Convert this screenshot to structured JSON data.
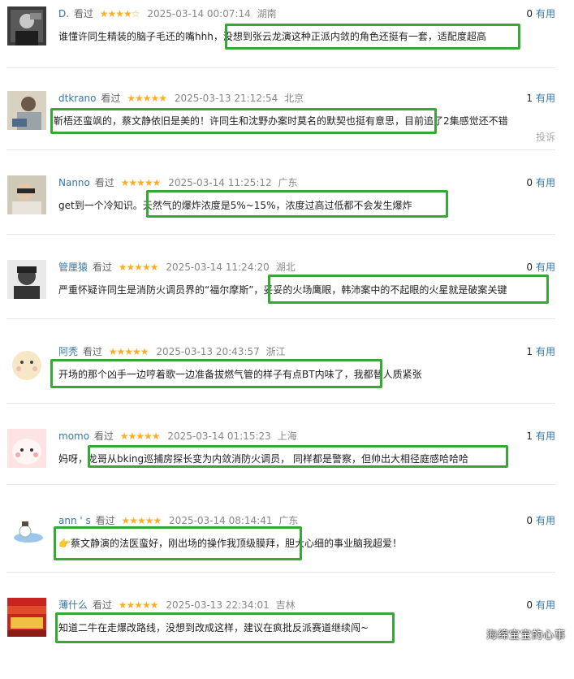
{
  "labels": {
    "watched": "看过",
    "useful": "有用",
    "report": "投诉"
  },
  "colors": {
    "username": "#3377aa",
    "star": "#ffac2d",
    "highlight": "#35a835"
  },
  "comments": [
    {
      "user": "D.",
      "stars": "★★★★☆",
      "time": "2025-03-14 00:07:14",
      "location": "湖南",
      "votes": "0",
      "text": "谁懂许同生精装的脑子毛还的嘴hhh，没想到张云龙演这种正派内敛的角色还挺有一套，适配度超高"
    },
    {
      "user": "dtkrano",
      "stars": "★★★★★",
      "time": "2025-03-13 21:12:54",
      "location": "北京",
      "votes": "1",
      "text": "靳梧还蛮飒的，蔡文静依旧是美的！许同生和沈野办案时莫名的默契也挺有意思，目前追了2集感觉还不错"
    },
    {
      "user": "Nanno",
      "stars": "★★★★★",
      "time": "2025-03-14 11:25:12",
      "location": "广东",
      "votes": "0",
      "text": "get到一个冷知识。天然气的爆炸浓度是5%~15%，浓度过高过低都不会发生爆炸"
    },
    {
      "user": "管厘猿",
      "stars": "★★★★★",
      "time": "2025-03-14 11:24:20",
      "location": "湖北",
      "votes": "0",
      "text": "严重怀疑许同生是消防火调员界的“福尔摩斯”，妥妥的火场鹰眼，韩沛案中的不起眼的火星就是破案关键"
    },
    {
      "user": "阿秃",
      "stars": "★★★★★",
      "time": "2025-03-13 20:43:57",
      "location": "浙江",
      "votes": "1",
      "text": "开场的那个凶手一边哼着歌一边准备拔燃气管的样子有点BT内味了，我都替人质紧张"
    },
    {
      "user": "momo",
      "stars": "★★★★★",
      "time": "2025-03-14 01:15:23",
      "location": "上海",
      "votes": "1",
      "text": "妈呀，龙哥从bking巡捕房探长变为内敛消防火调员， 同样都是警察，但帅出大相径庭感哈哈哈"
    },
    {
      "user": "ann ' s",
      "stars": "★★★★★",
      "time": "2025-03-14 08:14:41",
      "location": "广东",
      "votes": "0",
      "text": "👉蔡文静演的法医蛮好，刚出场的操作我顶级膜拜，胆大心细的事业脑我超爱！"
    },
    {
      "user": "薄什么",
      "stars": "★★★★★",
      "time": "2025-03-13 22:34:01",
      "location": "吉林",
      "votes": "0",
      "text": "知道二牛在走爆改路线，没想到改成这样，建议在疯批反派赛道继续闯~"
    }
  ],
  "watermark": "海绵宝宝的心事"
}
